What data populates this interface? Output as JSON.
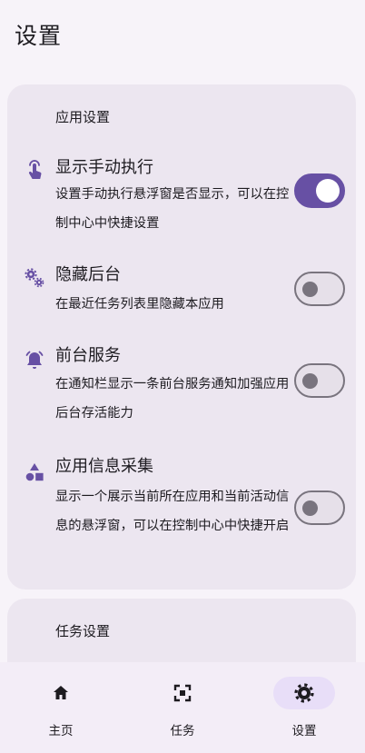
{
  "page": {
    "title": "设置"
  },
  "app_settings": {
    "section_title": "应用设置",
    "items": [
      {
        "icon": "touch-icon",
        "title": "显示手动执行",
        "description": "设置手动执行悬浮窗是否显示，可以在控制中心中快捷设置",
        "enabled": true
      },
      {
        "icon": "gears-icon",
        "title": "隐藏后台",
        "description": "在最近任务列表里隐藏本应用",
        "enabled": false
      },
      {
        "icon": "bell-icon",
        "title": "前台服务",
        "description": "在通知栏显示一条前台服务通知加强应用后台存活能力",
        "enabled": false
      },
      {
        "icon": "shapes-icon",
        "title": "应用信息采集",
        "description": "显示一个展示当前所在应用和当前活动信息的悬浮窗，可以在控制中心中快捷开启",
        "enabled": false
      }
    ]
  },
  "task_settings": {
    "section_title": "任务设置"
  },
  "bottom_nav": {
    "items": [
      {
        "icon": "home-icon",
        "label": "主页",
        "active": false
      },
      {
        "icon": "focus-frame-icon",
        "label": "任务",
        "active": false
      },
      {
        "icon": "settings-gear-icon",
        "label": "设置",
        "active": true
      }
    ]
  },
  "colors": {
    "background": "#f7f3f9",
    "card": "#ece6f0",
    "accent": "#6750a4",
    "switch_off_track": "#e6e0e9",
    "switch_off_outline": "#79747e",
    "nav_background": "#f3edf7",
    "nav_active_pill": "#e8def8"
  }
}
